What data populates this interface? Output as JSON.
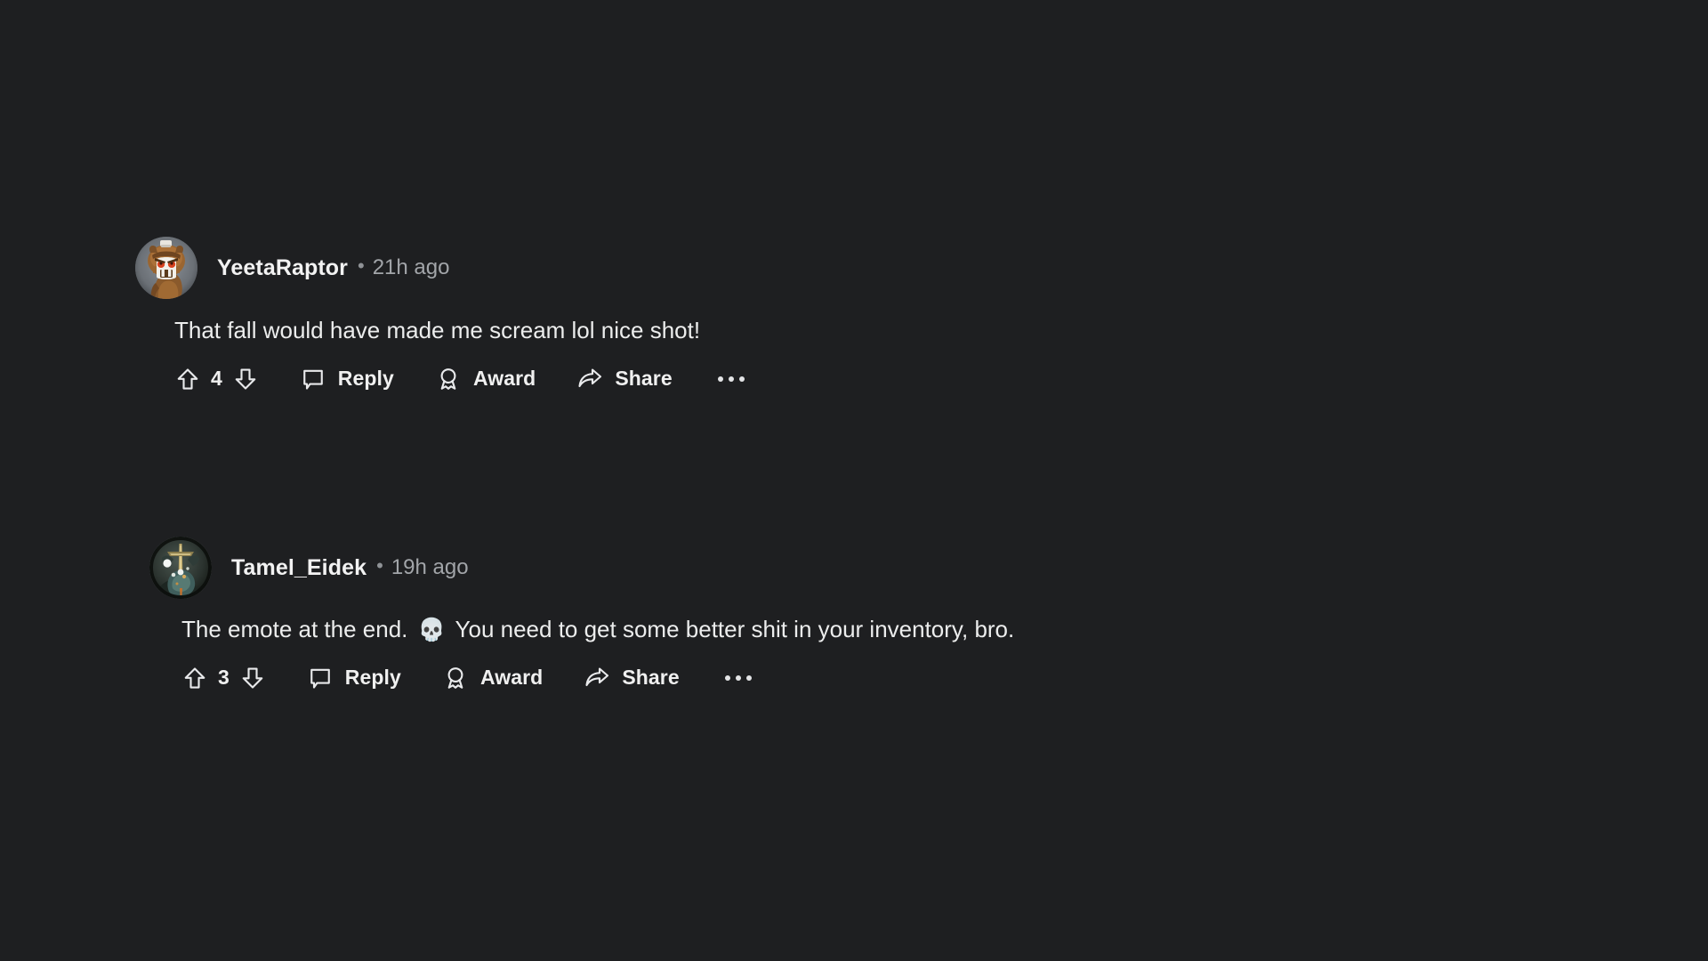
{
  "theme": {
    "background": "#1e1f21",
    "text_primary": "#eceded",
    "text_secondary": "#a2a5a9",
    "icon_stroke": "#e9eaec"
  },
  "comments": [
    {
      "author": "YeetaRaptor",
      "separator": "•",
      "timestamp": "21h ago",
      "body": "That fall would have made me scream lol nice shot!",
      "score": "4",
      "avatar_alt": "raptor-avatar",
      "actions": {
        "upvote_icon": "upvote-arrow-icon",
        "downvote_icon": "downvote-arrow-icon",
        "reply_icon": "comment-bubble-icon",
        "reply_label": "Reply",
        "award_icon": "award-ribbon-icon",
        "award_label": "Award",
        "share_icon": "share-arrow-icon",
        "share_label": "Share",
        "more_icon": "more-ellipsis-icon"
      }
    },
    {
      "author": "Tamel_Eidek",
      "separator": "•",
      "timestamp": "19h ago",
      "body_before_emoji": "The emote at the end.",
      "emoji": "💀",
      "body_after_emoji": "You need to get some better shit in your inventory, bro.",
      "score": "3",
      "avatar_alt": "creature-avatar",
      "actions": {
        "upvote_icon": "upvote-arrow-icon",
        "downvote_icon": "downvote-arrow-icon",
        "reply_icon": "comment-bubble-icon",
        "reply_label": "Reply",
        "award_icon": "award-ribbon-icon",
        "award_label": "Award",
        "share_icon": "share-arrow-icon",
        "share_label": "Share",
        "more_icon": "more-ellipsis-icon"
      }
    }
  ]
}
